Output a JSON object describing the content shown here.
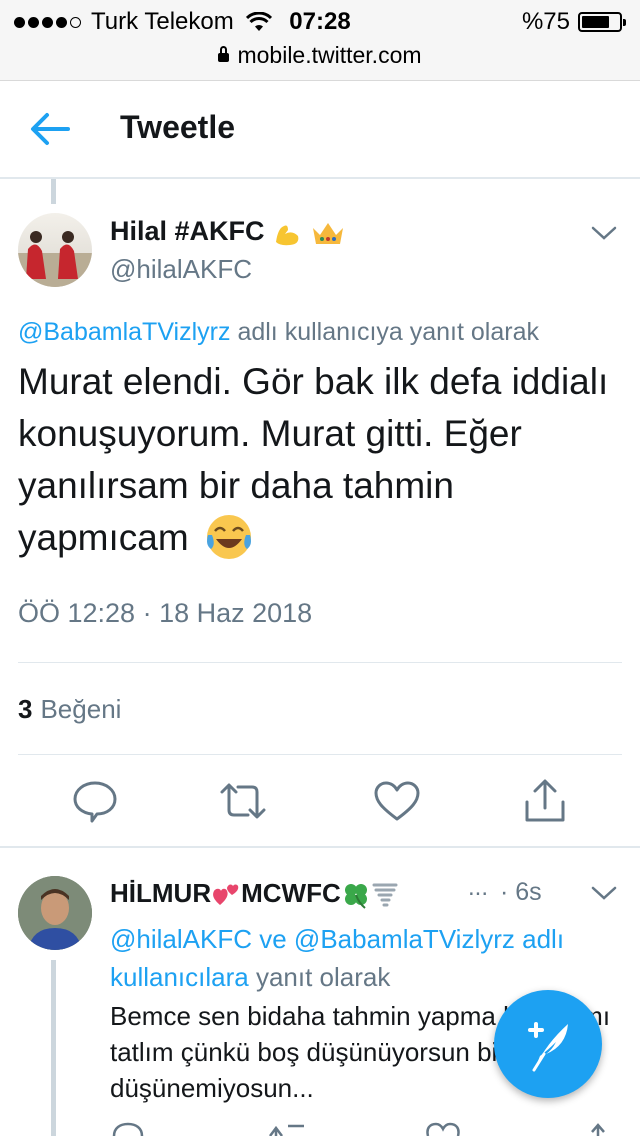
{
  "status_bar": {
    "carrier": "Turk Telekom",
    "time": "07:28",
    "battery_text": "%75",
    "battery_level": 0.75,
    "signal_dots": 4,
    "url": "mobile.twitter.com"
  },
  "header": {
    "title": "Tweetle"
  },
  "main_tweet": {
    "author_name": "Hilal #AKFC",
    "author_emojis": [
      "flexed-biceps",
      "crown"
    ],
    "handle": "@hilalAKFC",
    "reply_to_mention": "@BabamlaTVizlyrz",
    "reply_to_suffix": "adlı kullanıcıya yanıt olarak",
    "text": "Murat elendi. Gör bak ilk defa iddialı konuşuyorum. Murat gitti. Eğer yanılırsam bir daha tahmin yapmıcam",
    "text_emoji": "face-with-tears-of-joy",
    "timestamp": "ÖÖ 12:28 · 18 Haz 2018",
    "like_count": "3",
    "like_label": "Beğeni",
    "actions": [
      "reply-icon",
      "retweet-icon",
      "like-icon",
      "share-icon"
    ]
  },
  "reply_tweet": {
    "author_name_part1": "HİLMUR",
    "author_name_part2": "MCWFC",
    "author_emojis": [
      "two-hearts",
      "four-leaf-clover",
      "tornado"
    ],
    "ellipsis": "...",
    "time": "· 6s",
    "mention1": "@hilalAKFC",
    "connector": "ve",
    "mention2": "@BabamlaTVizlyrz",
    "mention_suffix_blue": "adlı kullanıcılara",
    "mention_suffix": "yanıt olarak",
    "text": "Bemce sen bidaha tahmin yapma bence mı tatlım çünkü boş düşünüyorsun bir daha düşünemiyosun..."
  },
  "fab": {
    "icon": "compose-feather-icon"
  },
  "colors": {
    "accent": "#1da1f2",
    "secondary_text": "#657786",
    "primary_text": "#14171a",
    "divider": "#e1e8ed"
  }
}
